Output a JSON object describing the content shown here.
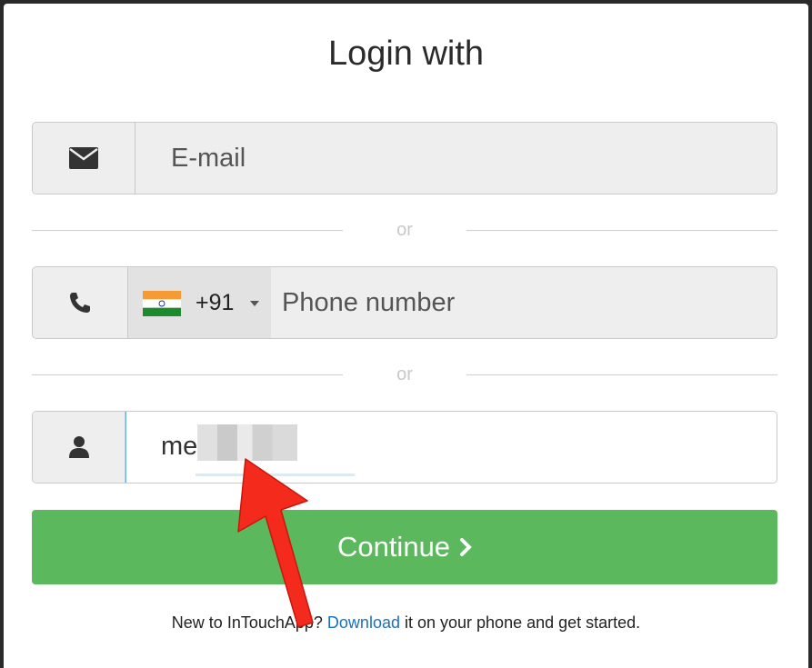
{
  "modal": {
    "title": "Login with"
  },
  "email": {
    "icon": "envelope-icon",
    "placeholder": "E-mail"
  },
  "separator": {
    "text": "or"
  },
  "phone": {
    "icon": "phone-icon",
    "country_flag": "india-flag-icon",
    "dial_code": "+91",
    "placeholder": "Phone number"
  },
  "username": {
    "icon": "user-icon",
    "value": "me"
  },
  "continue_button": {
    "label": "Continue",
    "color": "#5cb85c"
  },
  "footer": {
    "prefix": "New to InTouchApp?",
    "link": "Download",
    "suffix": "it on your phone and get started."
  },
  "annotation": {
    "arrow_color": "#f42a1c"
  }
}
